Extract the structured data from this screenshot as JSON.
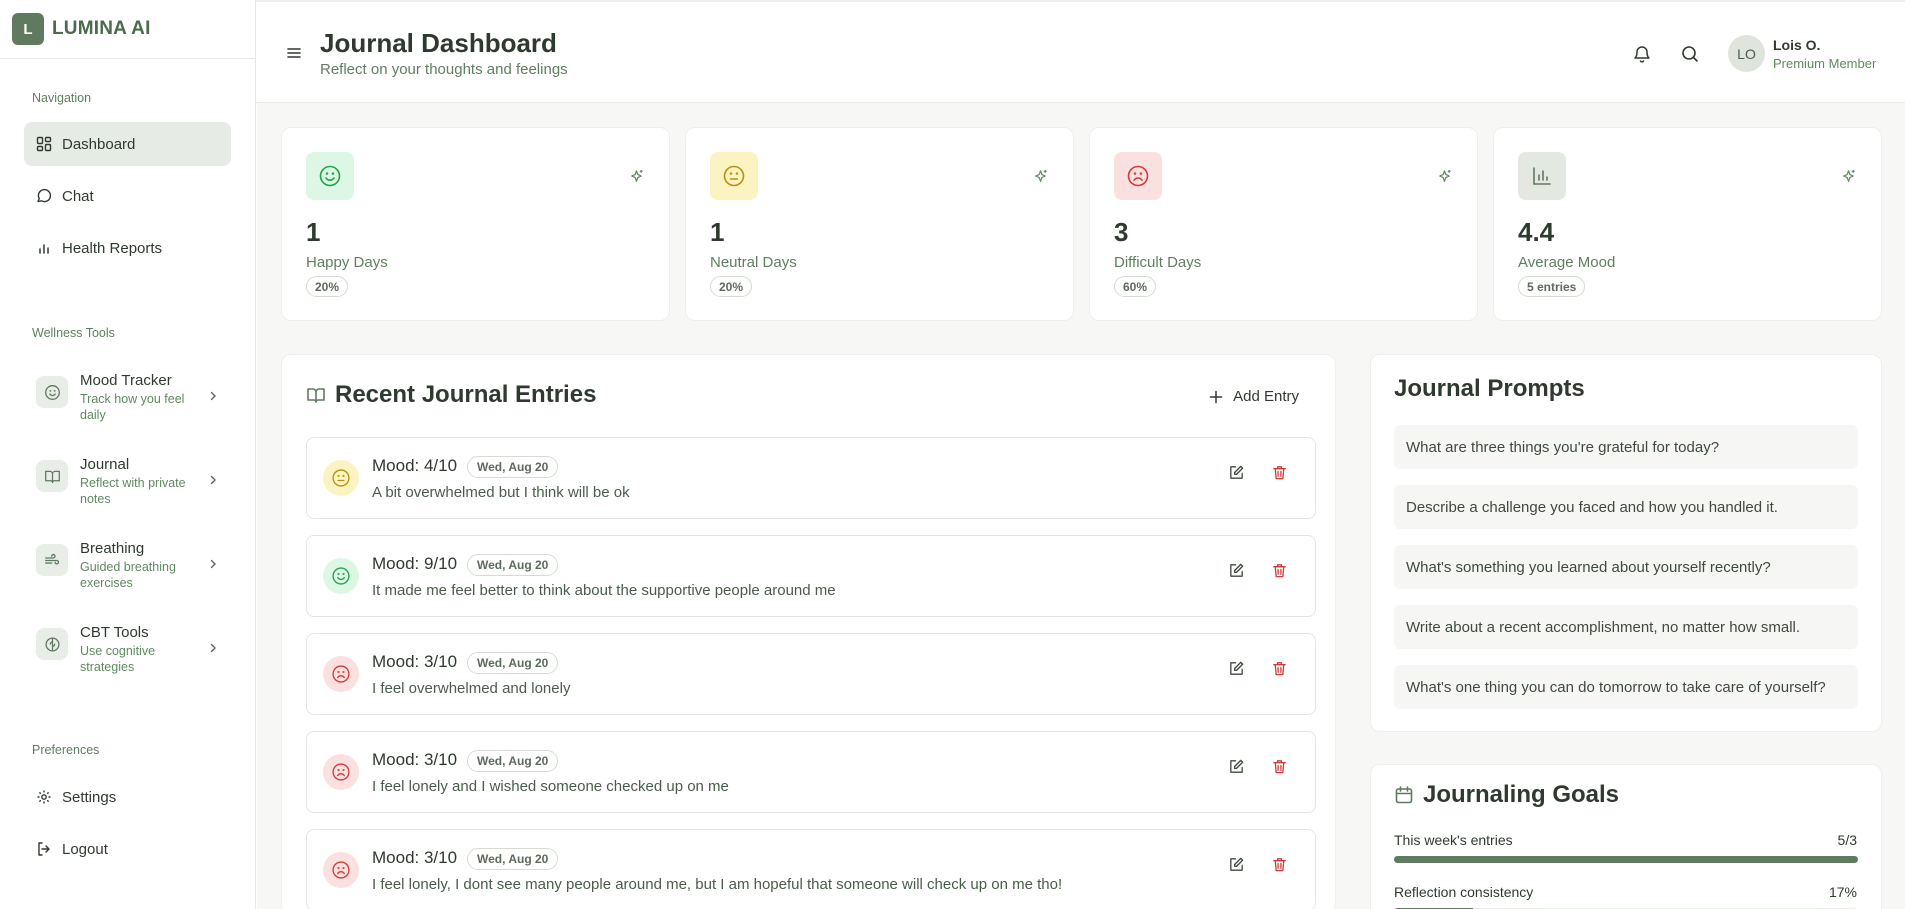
{
  "brand": {
    "logo_letter": "L",
    "name": "LUMINA AI"
  },
  "sidebar": {
    "nav_title": "Navigation",
    "nav_items": [
      {
        "label": "Dashboard",
        "icon": "grid-icon",
        "active": true
      },
      {
        "label": "Chat",
        "icon": "chat-icon",
        "active": false
      },
      {
        "label": "Health Reports",
        "icon": "bar-chart-icon",
        "active": false
      }
    ],
    "tools_title": "Wellness Tools",
    "tools": [
      {
        "title": "Mood Tracker",
        "subtitle": "Track how you feel daily",
        "icon": "smile-icon"
      },
      {
        "title": "Journal",
        "subtitle": "Reflect with private notes",
        "icon": "book-icon"
      },
      {
        "title": "Breathing",
        "subtitle": "Guided breathing exercises",
        "icon": "wind-icon"
      },
      {
        "title": "CBT Tools",
        "subtitle": "Use cognitive strategies",
        "icon": "brain-icon"
      }
    ],
    "prefs_title": "Preferences",
    "prefs": [
      {
        "label": "Settings",
        "icon": "gear-icon"
      },
      {
        "label": "Logout",
        "icon": "logout-icon"
      }
    ]
  },
  "header": {
    "title": "Journal Dashboard",
    "subtitle": "Reflect on your thoughts and feelings",
    "user": {
      "initials": "LO",
      "name": "Lois O.",
      "role": "Premium Member"
    }
  },
  "stats": [
    {
      "value": "1",
      "label": "Happy Days",
      "badge": "20%",
      "icon": "smile-icon",
      "color": "#22a34a",
      "bg": "#dcf7e4"
    },
    {
      "value": "1",
      "label": "Neutral Days",
      "badge": "20%",
      "icon": "neutral-face-icon",
      "color": "#b8900a",
      "bg": "#fbf4c2"
    },
    {
      "value": "3",
      "label": "Difficult Days",
      "badge": "60%",
      "icon": "frown-icon",
      "color": "#d33a3a",
      "bg": "#fbe0e0"
    },
    {
      "value": "4.4",
      "label": "Average Mood",
      "badge": "5 entries",
      "icon": "bar-chart-icon",
      "color": "#5f7a5f",
      "bg": "#e3e8e1"
    }
  ],
  "entries": {
    "title": "Recent Journal Entries",
    "add_label": "Add Entry",
    "items": [
      {
        "mood": "Mood: 4/10",
        "date": "Wed, Aug 20",
        "text": "A bit overwhelmed but I think will be ok",
        "face": "neutral"
      },
      {
        "mood": "Mood: 9/10",
        "date": "Wed, Aug 20",
        "text": "It made me feel better to think about the supportive people around me",
        "face": "happy"
      },
      {
        "mood": "Mood: 3/10",
        "date": "Wed, Aug 20",
        "text": "I feel overwhelmed and lonely",
        "face": "sad"
      },
      {
        "mood": "Mood: 3/10",
        "date": "Wed, Aug 20",
        "text": "I feel lonely and I wished someone checked up on me",
        "face": "sad"
      },
      {
        "mood": "Mood: 3/10",
        "date": "Wed, Aug 20",
        "text": "I feel lonely, I dont see many people around me, but I am hopeful that someone will check up on me tho!",
        "face": "sad"
      }
    ]
  },
  "prompts": {
    "title": "Journal Prompts",
    "items": [
      "What are three things you're grateful for today?",
      "Describe a challenge you faced and how you handled it.",
      "What's something you learned about yourself recently?",
      "Write about a recent accomplishment, no matter how small.",
      "What's one thing you can do tomorrow to take care of yourself?"
    ]
  },
  "goals": {
    "title": "Journaling Goals",
    "items": [
      {
        "label": "This week's entries",
        "value": "5/3",
        "progress": 1.0
      },
      {
        "label": "Reflection consistency",
        "value": "17%",
        "progress": 0.17
      }
    ]
  }
}
